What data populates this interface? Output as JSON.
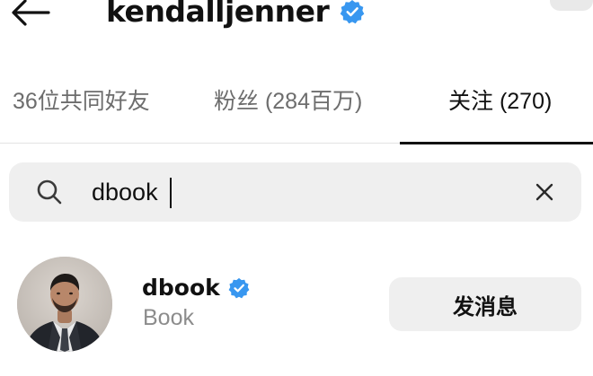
{
  "header": {
    "username": "kendalljenner",
    "verified": true
  },
  "tabs": [
    {
      "label": "36位共同好友",
      "active": false
    },
    {
      "label": "粉丝 (284百万)",
      "active": false
    },
    {
      "label": "关注 (270)",
      "active": true
    }
  ],
  "search": {
    "value": "dbook",
    "placeholder": "",
    "icon": "search-icon",
    "clear_icon": "close-icon"
  },
  "results": [
    {
      "username": "dbook",
      "verified": true,
      "full_name": "Book",
      "action_label": "发消息"
    }
  ],
  "colors": {
    "verified_blue": "#3897f0",
    "tab_active": "#111111",
    "tab_inactive": "#6d6d6d",
    "subtext": "#8c8c8c",
    "search_bg": "#efefef",
    "button_bg": "#efefef"
  }
}
